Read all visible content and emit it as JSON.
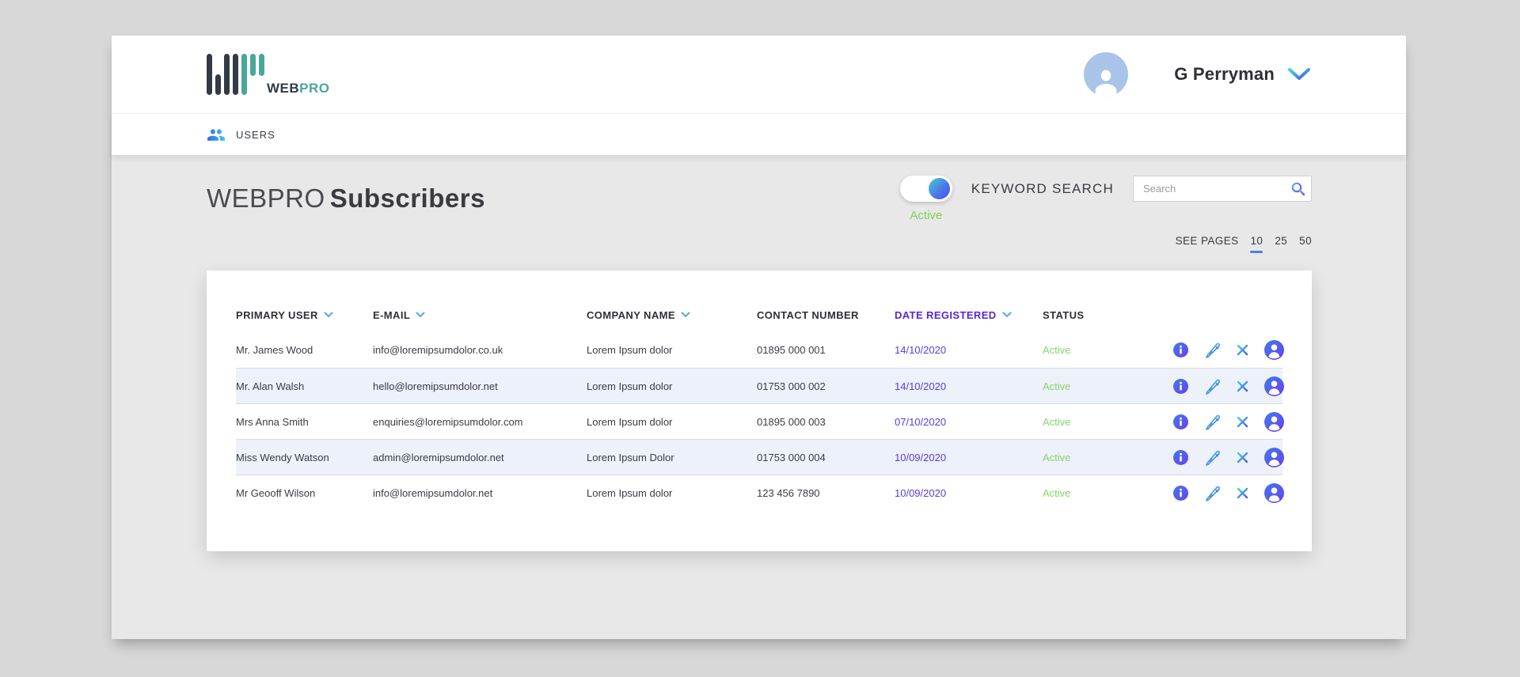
{
  "brand": {
    "logo_text_primary": "WEB",
    "logo_text_secondary": "PRO"
  },
  "header": {
    "user_name": "G Perryman"
  },
  "nav": {
    "users_label": "USERS"
  },
  "page": {
    "title_light": "WEBPRO",
    "title_bold": "Subscribers",
    "toggle_state_label": "Active",
    "keyword_search_label": "KEYWORD SEARCH",
    "search_placeholder": "Search",
    "see_pages_label": "SEE PAGES",
    "page_sizes": [
      "10",
      "25",
      "50"
    ],
    "selected_page_size": "10"
  },
  "table": {
    "columns": [
      {
        "label": "PRIMARY USER"
      },
      {
        "label": "E-MAIL"
      },
      {
        "label": "COMPANY NAME"
      },
      {
        "label": "CONTACT NUMBER"
      },
      {
        "label": "DATE REGISTERED"
      },
      {
        "label": "STATUS"
      }
    ],
    "rows": [
      {
        "primary_user": "Mr. James Wood",
        "email": "info@loremipsumdolor.co.uk",
        "company": "Lorem Ipsum dolor",
        "contact": "01895 000 001",
        "date_registered": "14/10/2020",
        "status": "Active"
      },
      {
        "primary_user": "Mr. Alan Walsh",
        "email": "hello@loremipsumdolor.net",
        "company": "Lorem Ipsum dolor",
        "contact": "01753 000 002",
        "date_registered": "14/10/2020",
        "status": "Active"
      },
      {
        "primary_user": "Mrs Anna Smith",
        "email": "enquiries@loremipsumdolor.com",
        "company": "Lorem Ipsum dolor",
        "contact": "01895 000 003",
        "date_registered": "07/10/2020",
        "status": "Active"
      },
      {
        "primary_user": "Miss Wendy Watson",
        "email": "admin@loremipsumdolor.net",
        "company": "Lorem Ipsum Dolor",
        "contact": "01753 000 004",
        "date_registered": "10/09/2020",
        "status": "Active"
      },
      {
        "primary_user": "Mr Geooff Wilson",
        "email": "info@loremipsumdolor.net",
        "company": "Lorem Ipsum dolor",
        "contact": "123 456 7890",
        "date_registered": "10/09/2020",
        "status": "Active"
      }
    ],
    "row_actions": [
      "info",
      "edit",
      "delete",
      "user-profile"
    ]
  },
  "colors": {
    "accent_teal": "#43d1c9",
    "accent_blue": "#4b5bf0",
    "accent_purple_date": "#5b3bdb",
    "sorted_header_purple": "#5527d8",
    "status_green": "#85d56b",
    "toggle_label_green": "#7ed150",
    "sort_chevron_blue": "#58a6f0",
    "row_stripe": "#edf1fa",
    "logo_dark": "#323a45",
    "logo_teal": "#4ba69a",
    "page_size_underline": "#4a7cf0"
  }
}
